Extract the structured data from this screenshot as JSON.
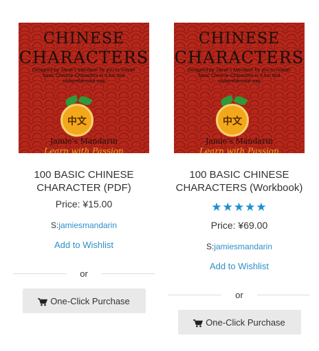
{
  "products": [
    {
      "cover": {
        "title_line1": "CHINESE",
        "title_line2": "CHARACTERS",
        "blurb": "Designed by Jamie's Mandarin for you to master basic Chinese Characters in a fun and comprehensive way",
        "logo_text": "中文",
        "brand": "Jamie's Mandarin",
        "tagline": "Learn with Passion"
      },
      "title": "100 BASIC CHINESE CHARACTER (PDF)",
      "rating": null,
      "price": "Price:  ¥15.00",
      "seller_prefix": "S:",
      "seller_name": "jamiesmandarin",
      "wishlist_label": "Add to Wishlist",
      "or_label": "or",
      "buy_label": "One-Click Purchase"
    },
    {
      "cover": {
        "title_line1": "CHINESE",
        "title_line2": "CHARACTERS",
        "blurb": "Designed by Jamie's Mandarin for you to master basic Chinese Characters in a fun and comprehensive way",
        "logo_text": "中文",
        "brand": "Jamie's Mandarin",
        "tagline": "Learn with Passion"
      },
      "title": "100 BASIC CHINESE CHARACTERS (Workbook)",
      "rating": {
        "stars": "★★★★★",
        "value": 5,
        "max": 5
      },
      "price": "Price:  ¥69.00",
      "seller_prefix": "S:",
      "seller_name": "jamiesmandarin",
      "wishlist_label": "Add to Wishlist",
      "or_label": "or",
      "buy_label": "One-Click Purchase"
    }
  ],
  "icons": {
    "cart": "shopping-cart-icon"
  },
  "colors": {
    "link": "#2b8fc7",
    "star": "#1e8fd0",
    "cover_red": "#b8261a",
    "button_bg": "#e9e9e9"
  }
}
